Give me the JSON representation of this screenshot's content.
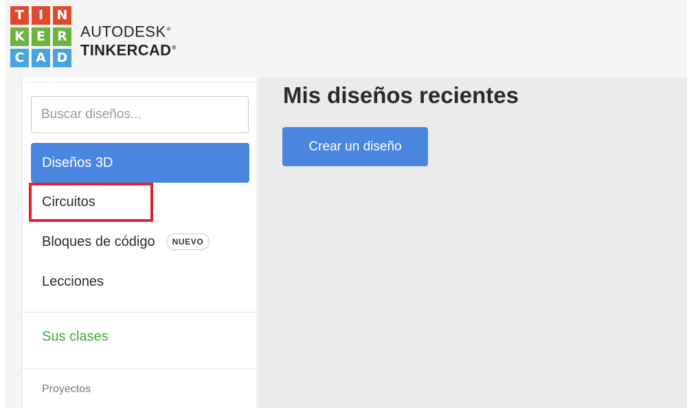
{
  "header": {
    "logo_letters": [
      {
        "letter": "T",
        "color": "#e0492c"
      },
      {
        "letter": "I",
        "color": "#e0492c"
      },
      {
        "letter": "N",
        "color": "#e0492c"
      },
      {
        "letter": "K",
        "color": "#6db33f"
      },
      {
        "letter": "E",
        "color": "#6db33f"
      },
      {
        "letter": "R",
        "color": "#6db33f"
      },
      {
        "letter": "C",
        "color": "#47a5dc"
      },
      {
        "letter": "A",
        "color": "#47a5dc"
      },
      {
        "letter": "D",
        "color": "#47a5dc"
      }
    ],
    "brand_top": "AUTODESK",
    "brand_bottom": "TINKERCAD",
    "registered_mark": "®"
  },
  "sidebar": {
    "search_placeholder": "Buscar diseños...",
    "items": [
      {
        "label": "Diseños 3D",
        "active": true
      },
      {
        "label": "Circuitos",
        "active": false
      },
      {
        "label": "Bloques de código",
        "active": false,
        "badge": "NUEVO"
      },
      {
        "label": "Lecciones",
        "active": false
      }
    ],
    "classes_link": "Sus clases",
    "section_label": "Proyectos"
  },
  "main": {
    "title": "Mis diseños recientes",
    "create_button": "Crear un diseño"
  },
  "colors": {
    "accent_blue": "#4a86e0",
    "classes_green": "#3daa3d",
    "highlight_red": "#e0202a",
    "main_bg": "#ebebeb",
    "header_bg": "#f5f5f5"
  }
}
